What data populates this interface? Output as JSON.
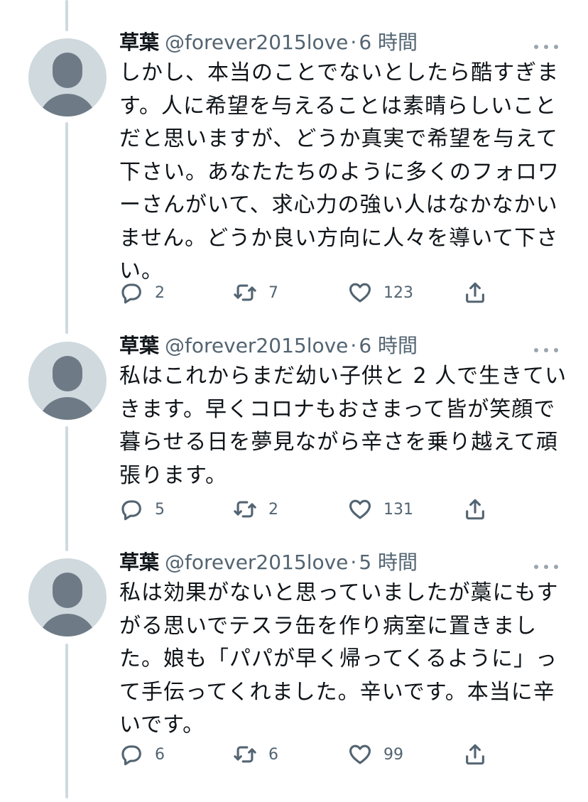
{
  "tweets": [
    {
      "name": "草葉",
      "handle": "@forever2015love",
      "separator": "·",
      "time": "6 時間",
      "lines": [
        "しかし、本当のことでないとしたら酷すぎま",
        "す。人に希望を与えることは素晴らしいこと",
        "だと思いますが、どうか真実で希望を与えて",
        "下さい。あなたたちのように多くのフォロワ",
        "ーさんがいて、求心力の強い人はなかなかい",
        "ません。どうか良い方向に人々を導いて下さ",
        "い。"
      ],
      "replies": "2",
      "retweets": "7",
      "likes": "123"
    },
    {
      "name": "草葉",
      "handle": "@forever2015love",
      "separator": "·",
      "time": "6 時間",
      "lines": [
        "私はこれからまだ幼い子供と 2 人で生きてい",
        "きます。早くコロナもおさまって皆が笑顔で",
        "暮らせる日を夢見ながら辛さを乗り越えて頑",
        "張ります。"
      ],
      "replies": "5",
      "retweets": "2",
      "likes": "131"
    },
    {
      "name": "草葉",
      "handle": "@forever2015love",
      "separator": "·",
      "time": "5 時間",
      "lines": [
        "私は効果がないと思っていましたが藁にもす",
        "がる思いでテスラ缶を作り病室に置きまし",
        "た。娘も「パパが早く帰ってくるように」っ",
        "て手伝ってくれました。辛いです。本当に辛",
        "いです。"
      ],
      "replies": "6",
      "retweets": "6",
      "likes": "99"
    }
  ],
  "icons": {
    "reply": "reply-icon",
    "retweet": "retweet-icon",
    "like": "heart-icon",
    "share": "share-icon",
    "more": "more-icon",
    "avatar": "default-avatar-icon"
  },
  "colors": {
    "text": "#0f1419",
    "secondary": "#536471",
    "thread_line": "#cfd9de",
    "avatar_bg": "#cfd9de",
    "avatar_fg": "#6e7b86"
  }
}
